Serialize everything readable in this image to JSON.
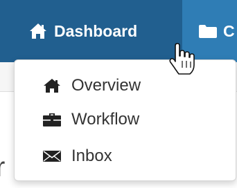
{
  "navbar": {
    "items": [
      {
        "label": "Dashboard",
        "icon": "home-icon",
        "active": true
      },
      {
        "label": "C",
        "icon": "folder-icon",
        "active": false
      }
    ]
  },
  "dropdown": {
    "items": [
      {
        "label": "Overview",
        "icon": "home-icon"
      },
      {
        "label": "Workflow",
        "icon": "briefcase-icon"
      },
      {
        "label": "Inbox",
        "icon": "envelope-icon"
      }
    ]
  },
  "background_text": "r",
  "colors": {
    "navbar": "#2f7db5",
    "navbar_active": "#215f8f",
    "menu_text": "#333333"
  }
}
